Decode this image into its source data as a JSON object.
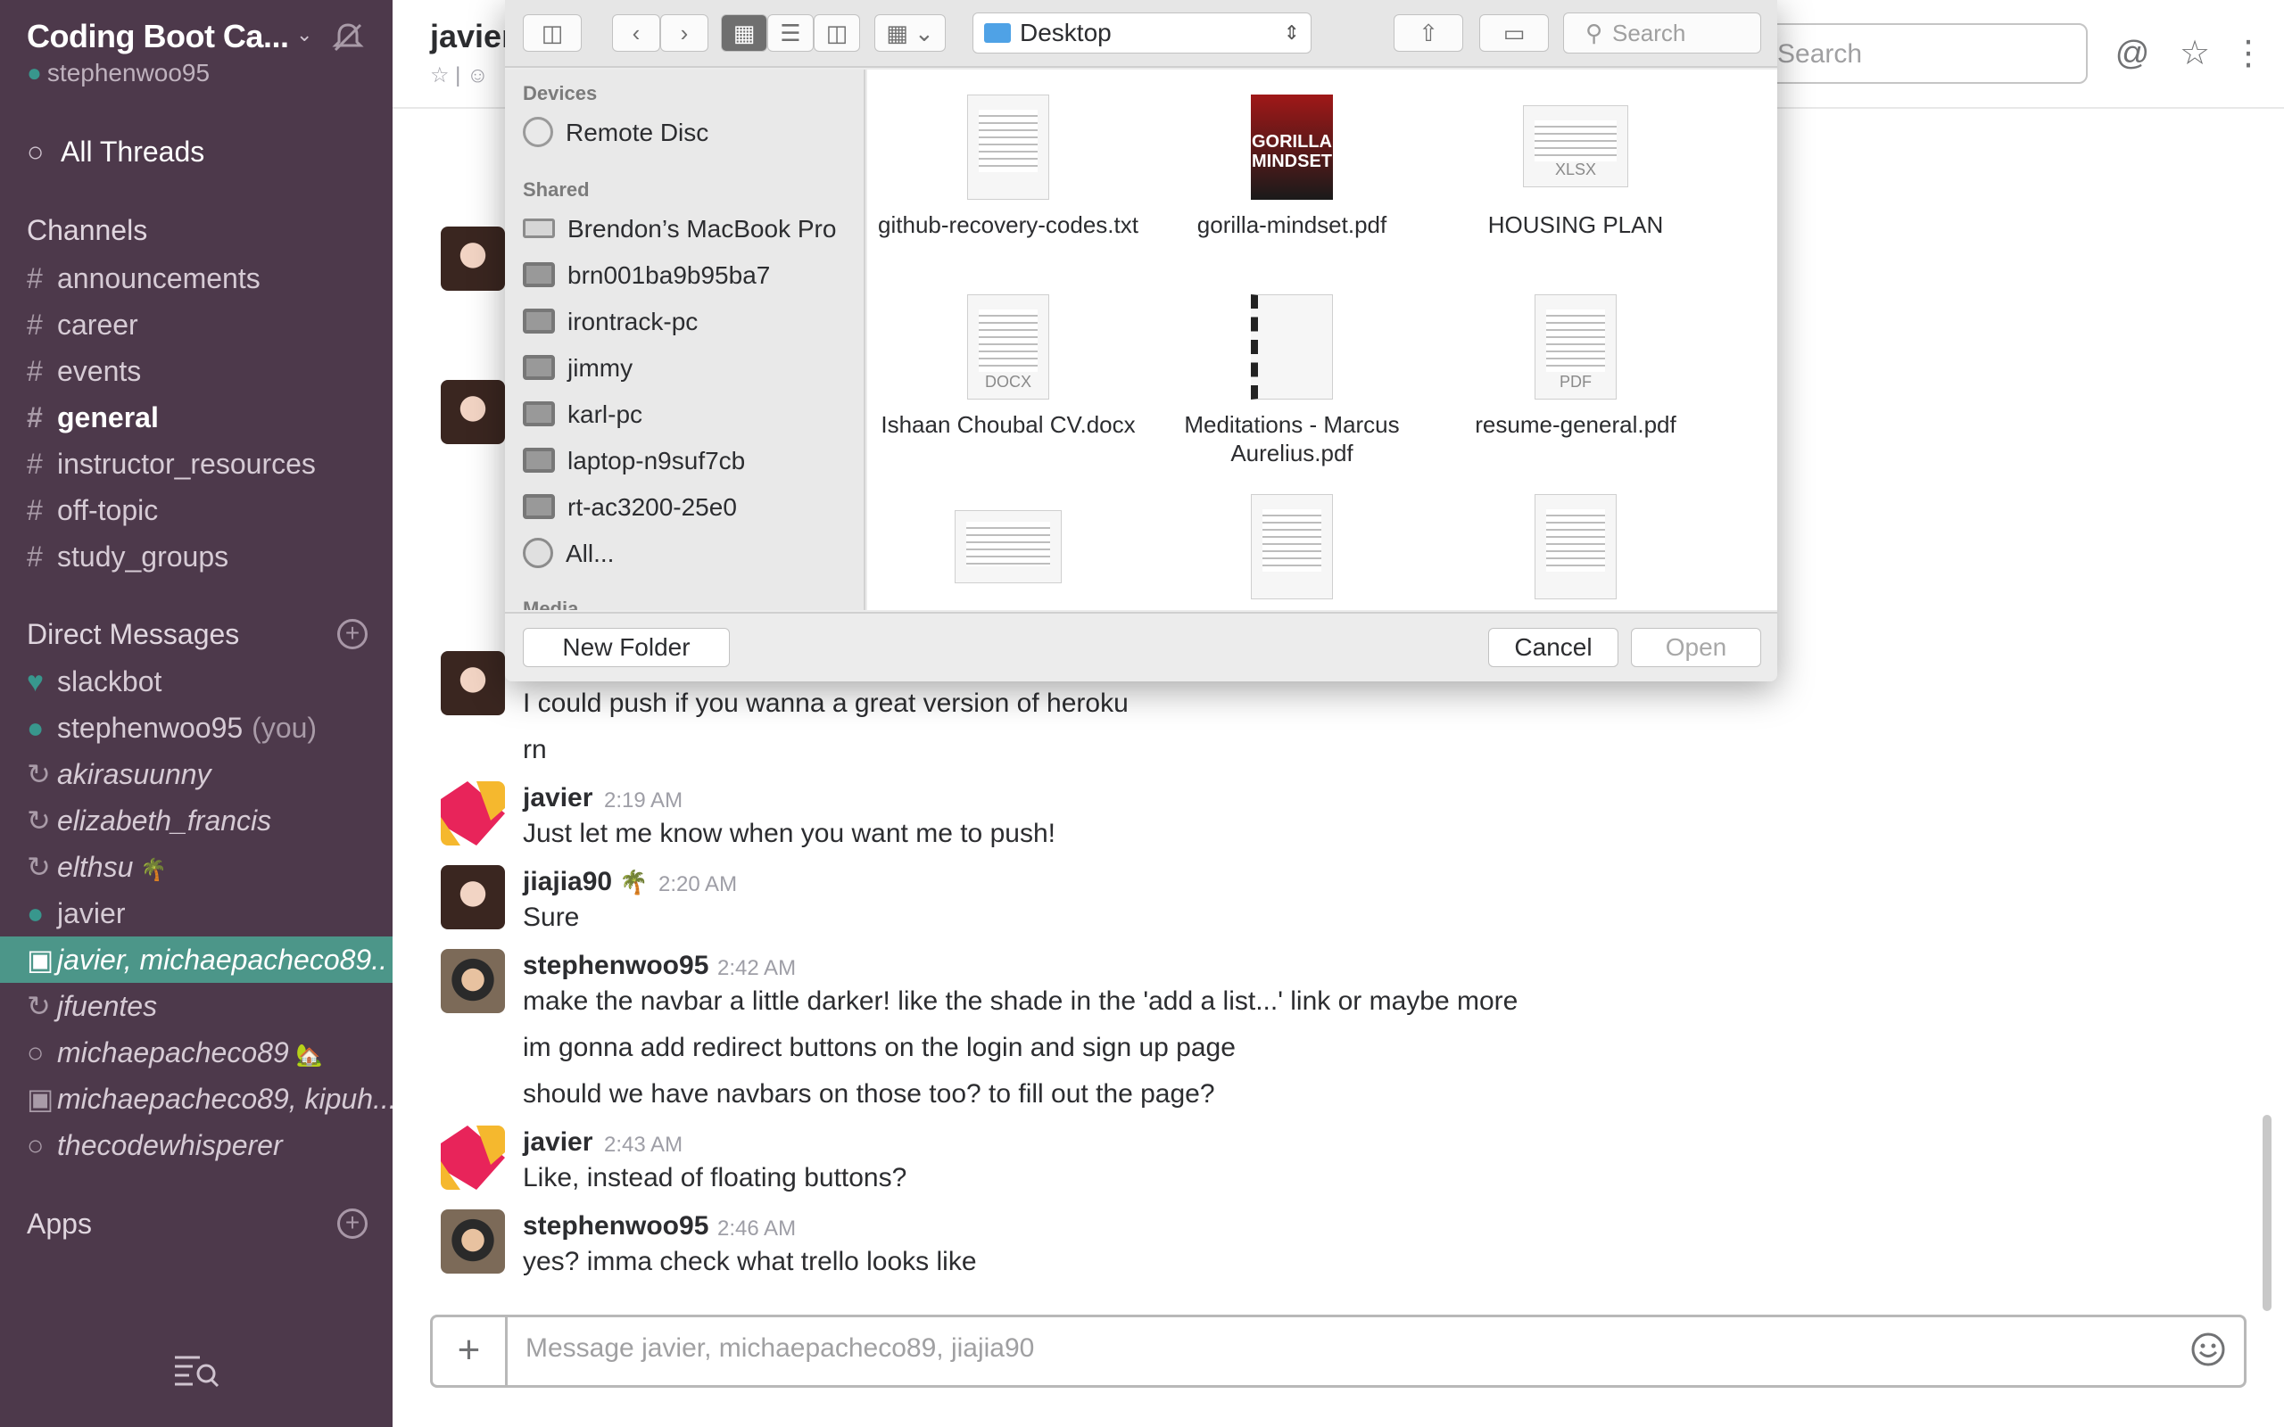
{
  "sidebar": {
    "team_name": "Coding Boot Ca...",
    "username": "stephenwoo95",
    "all_threads": "All Threads",
    "channels_header": "Channels",
    "channels": [
      {
        "label": "announcements"
      },
      {
        "label": "career"
      },
      {
        "label": "events"
      },
      {
        "label": "general"
      },
      {
        "label": "instructor_resources"
      },
      {
        "label": "off-topic"
      },
      {
        "label": "study_groups"
      }
    ],
    "dm_header": "Direct Messages",
    "dms": [
      {
        "label": "slackbot"
      },
      {
        "label": "stephenwoo95",
        "suffix": "(you)"
      },
      {
        "label": "akirasuunny"
      },
      {
        "label": "elizabeth_francis"
      },
      {
        "label": "elthsu"
      },
      {
        "label": "javier"
      },
      {
        "label": "javier, michaepacheco89.."
      },
      {
        "label": "jfuentes"
      },
      {
        "label": "michaepacheco89"
      },
      {
        "label": "michaepacheco89, kipuh..."
      },
      {
        "label": "thecodewhisperer"
      }
    ],
    "apps_header": "Apps"
  },
  "header": {
    "title": "javier",
    "search_placeholder": "Search"
  },
  "messages": [
    {
      "text": "I could push if you wanna a great version of heroku"
    },
    {
      "text": "rn"
    },
    {
      "name": "javier",
      "time": "2:19 AM",
      "text": "Just let me know when you want me to push!"
    },
    {
      "name": "jiajia90",
      "time": "2:20 AM",
      "text": "Sure"
    },
    {
      "name": "stephenwoo95",
      "time": "2:42 AM",
      "lines": [
        "make the navbar a little darker! like the shade in the 'add a list...' link or maybe more",
        "im gonna add redirect buttons on the login and sign up page",
        "should we have navbars on those too? to fill out the page?"
      ]
    },
    {
      "name": "javier",
      "time": "2:43 AM",
      "text": "Like, instead of floating buttons?"
    },
    {
      "name": "stephenwoo95",
      "time": "2:46 AM",
      "text": "yes? imma check what trello looks like"
    }
  ],
  "composer": {
    "placeholder": "Message javier, michaepacheco89, jiajia90"
  },
  "dialog": {
    "location": "Desktop",
    "search_placeholder": "Search",
    "devices_header": "Devices",
    "devices": [
      {
        "label": "Remote Disc",
        "icon": "disc-icon"
      }
    ],
    "shared_header": "Shared",
    "shared": [
      {
        "label": "Brendon’s MacBook Pro",
        "icon": "laptop-icon"
      },
      {
        "label": "brn001ba9b95ba7",
        "icon": "monitor-icon"
      },
      {
        "label": "irontrack-pc",
        "icon": "monitor-icon"
      },
      {
        "label": "jimmy",
        "icon": "monitor-icon"
      },
      {
        "label": "karl-pc",
        "icon": "monitor-icon"
      },
      {
        "label": "laptop-n9suf7cb",
        "icon": "monitor-icon"
      },
      {
        "label": "rt-ac3200-25e0",
        "icon": "monitor-icon"
      },
      {
        "label": "All...",
        "icon": "globe-icon"
      }
    ],
    "media_header": "Media",
    "files": [
      {
        "name": "github-recovery-codes.txt",
        "ext": ""
      },
      {
        "name": "gorilla-mindset.pdf",
        "ext": "",
        "cover": "GORILLA MINDSET"
      },
      {
        "name": "HOUSING PLAN",
        "ext": "XLSX"
      },
      {
        "name": "Ishaan Choubal CV.docx",
        "ext": "DOCX"
      },
      {
        "name": "Meditations - Marcus Aurelius.pdf",
        "ext": ""
      },
      {
        "name": "resume-general.pdf",
        "ext": "PDF"
      }
    ],
    "new_folder": "New Folder",
    "cancel": "Cancel",
    "open": "Open"
  }
}
